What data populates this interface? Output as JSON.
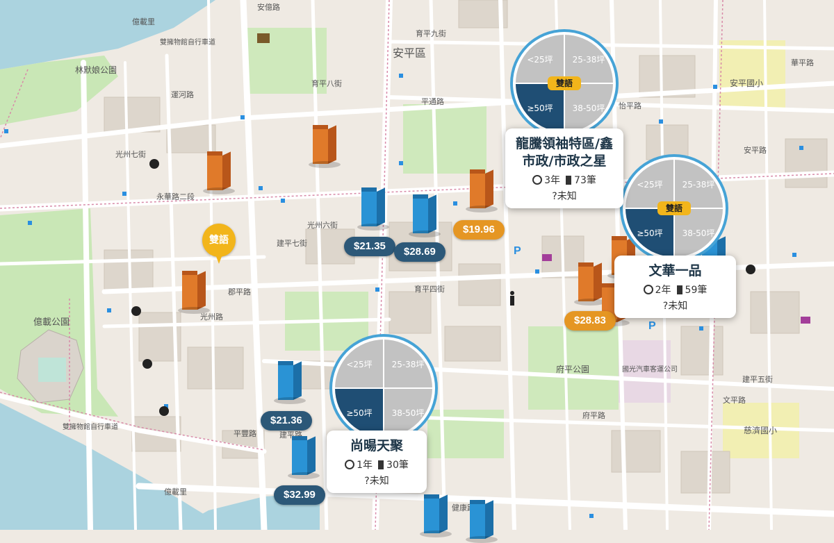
{
  "colors": {
    "price_blue": "#2c5878",
    "price_orange": "#e59623",
    "pie_dark": "#1f4e74",
    "pie_light": "#c2c2c2",
    "pie_ring": "#46a3d6",
    "badge_yellow": "#f2b51b"
  },
  "pie_labels": {
    "lt25": "<25坪",
    "p25_38": "25-38坪",
    "ge50": "≥50坪",
    "p38_50": "38-50坪",
    "badge": "雙語"
  },
  "pin_label": "雙語",
  "prices": {
    "p1": "$21.35",
    "p2": "$28.69",
    "p3": "$19.96",
    "p4": "$28.83",
    "p5": "$21.36",
    "p6": "$32.99"
  },
  "cards": {
    "longteng": {
      "title": "龍騰領袖特區/鑫市政/市政之星",
      "age": "3年",
      "count": "73筆",
      "status": "未知"
    },
    "wenhua": {
      "title": "文華一品",
      "age": "2年",
      "count": "59筆",
      "status": "未知"
    },
    "shangyang": {
      "title": "尚暘天聚",
      "age": "1年",
      "count": "30筆",
      "status": "未知"
    }
  },
  "map_labels": {
    "anping_district": "安平區",
    "lin_park": "林默娘公園",
    "yizai_park": "億載公園",
    "fuping_park": "府平公園",
    "anping_school": "安平國小",
    "cide_school": "慈濟國小",
    "guoguang_bus": "國光汽車客運公司",
    "yizai_li": "億載里",
    "yizai_li2": "億載里",
    "bike_road1": "雙擁物館自行車道",
    "bike_road2": "雙擁物館自行車道",
    "yonghua_rd": "永華路二段",
    "jianping_rd": "建平路",
    "guangzhou_rd": "光州路",
    "anyi_rd": "安億路",
    "yuping_9": "育平九街",
    "yuping_8": "育平八街",
    "yuping_4": "育平四街",
    "jiankang_3": "健康路三段",
    "ping_tong_rd": "平通路",
    "ping_feng_rd": "平豐路",
    "fuping_rd": "府平路",
    "junping_rd": "郡平路",
    "huaping_rd": "華平路",
    "yiping_rd": "怡平路",
    "jianping_7": "建平七街",
    "jianping_5": "建平五街",
    "wenping_rd": "文平路",
    "guangzhou_7": "光州七街",
    "guangzhou_6": "光州六街",
    "anping_rd": "安平路",
    "yunhe_rd": "運河路"
  }
}
